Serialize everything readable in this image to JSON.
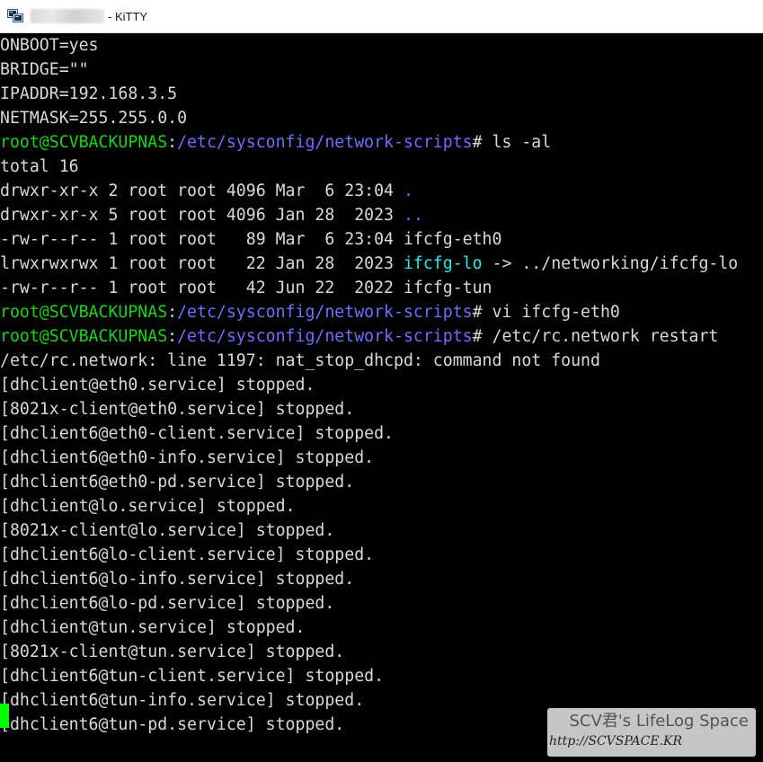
{
  "window": {
    "title": "- KiTTY",
    "icon": "putty-terminal-icon"
  },
  "colors": {
    "prompt_user": "#19d419",
    "prompt_path": "#6e6eff",
    "dir_link": "#2ee8e8",
    "text": "#d9d9d9",
    "cursor": "#00ff00",
    "background": "#000000"
  },
  "terminal": {
    "lines": [
      [
        {
          "t": "ONBOOT=yes",
          "c": "white"
        }
      ],
      [
        {
          "t": "BRIDGE=\"\"",
          "c": "white"
        }
      ],
      [
        {
          "t": "IPADDR=192.168.3.5",
          "c": "white"
        }
      ],
      [
        {
          "t": "NETMASK=255.255.0.0",
          "c": "white"
        }
      ],
      [
        {
          "t": "root@SCVBACKUPNAS",
          "c": "green"
        },
        {
          "t": ":",
          "c": "white"
        },
        {
          "t": "/etc/sysconfig/network-scripts",
          "c": "blue"
        },
        {
          "t": "# ls -al",
          "c": "white"
        }
      ],
      [
        {
          "t": "total 16",
          "c": "white"
        }
      ],
      [
        {
          "t": "drwxr-xr-x 2 root root 4096 Mar  6 23:04 ",
          "c": "white"
        },
        {
          "t": ".",
          "c": "blue"
        }
      ],
      [
        {
          "t": "drwxr-xr-x 5 root root 4096 Jan 28  2023 ",
          "c": "white"
        },
        {
          "t": "..",
          "c": "blue"
        }
      ],
      [
        {
          "t": "-rw-r--r-- 1 root root   89 Mar  6 23:04 ifcfg-eth0",
          "c": "white"
        }
      ],
      [
        {
          "t": "lrwxrwxrwx 1 root root   22 Jan 28  2023 ",
          "c": "white"
        },
        {
          "t": "ifcfg-lo",
          "c": "cyan"
        },
        {
          "t": " -> ../networking/ifcfg-lo",
          "c": "white"
        }
      ],
      [
        {
          "t": "-rw-r--r-- 1 root root   42 Jun 22  2022 ifcfg-tun",
          "c": "white"
        }
      ],
      [
        {
          "t": "root@SCVBACKUPNAS",
          "c": "green"
        },
        {
          "t": ":",
          "c": "white"
        },
        {
          "t": "/etc/sysconfig/network-scripts",
          "c": "blue"
        },
        {
          "t": "# vi ifcfg-eth0",
          "c": "white"
        }
      ],
      [
        {
          "t": "root@SCVBACKUPNAS",
          "c": "green"
        },
        {
          "t": ":",
          "c": "white"
        },
        {
          "t": "/etc/sysconfig/network-scripts",
          "c": "blue"
        },
        {
          "t": "# /etc/rc.network restart",
          "c": "white"
        }
      ],
      [
        {
          "t": "/etc/rc.network: line 1197: nat_stop_dhcpd: command not found",
          "c": "white"
        }
      ],
      [
        {
          "t": "[dhclient@eth0.service] stopped.",
          "c": "white"
        }
      ],
      [
        {
          "t": "[8021x-client@eth0.service] stopped.",
          "c": "white"
        }
      ],
      [
        {
          "t": "[dhclient6@eth0-client.service] stopped.",
          "c": "white"
        }
      ],
      [
        {
          "t": "[dhclient6@eth0-info.service] stopped.",
          "c": "white"
        }
      ],
      [
        {
          "t": "[dhclient6@eth0-pd.service] stopped.",
          "c": "white"
        }
      ],
      [
        {
          "t": "[dhclient@lo.service] stopped.",
          "c": "white"
        }
      ],
      [
        {
          "t": "[8021x-client@lo.service] stopped.",
          "c": "white"
        }
      ],
      [
        {
          "t": "[dhclient6@lo-client.service] stopped.",
          "c": "white"
        }
      ],
      [
        {
          "t": "[dhclient6@lo-info.service] stopped.",
          "c": "white"
        }
      ],
      [
        {
          "t": "[dhclient6@lo-pd.service] stopped.",
          "c": "white"
        }
      ],
      [
        {
          "t": "[dhclient@tun.service] stopped.",
          "c": "white"
        }
      ],
      [
        {
          "t": "[8021x-client@tun.service] stopped.",
          "c": "white"
        }
      ],
      [
        {
          "t": "[dhclient6@tun-client.service] stopped.",
          "c": "white"
        }
      ],
      [
        {
          "t": "[dhclient6@tun-info.service] stopped.",
          "c": "white"
        }
      ],
      [
        {
          "t": "[dhclient6@tun-pd.service] stopped.",
          "c": "white"
        }
      ]
    ]
  },
  "watermark": {
    "title": "SCV君's LifeLog Space",
    "url": "http://SCVSPACE.KR"
  }
}
